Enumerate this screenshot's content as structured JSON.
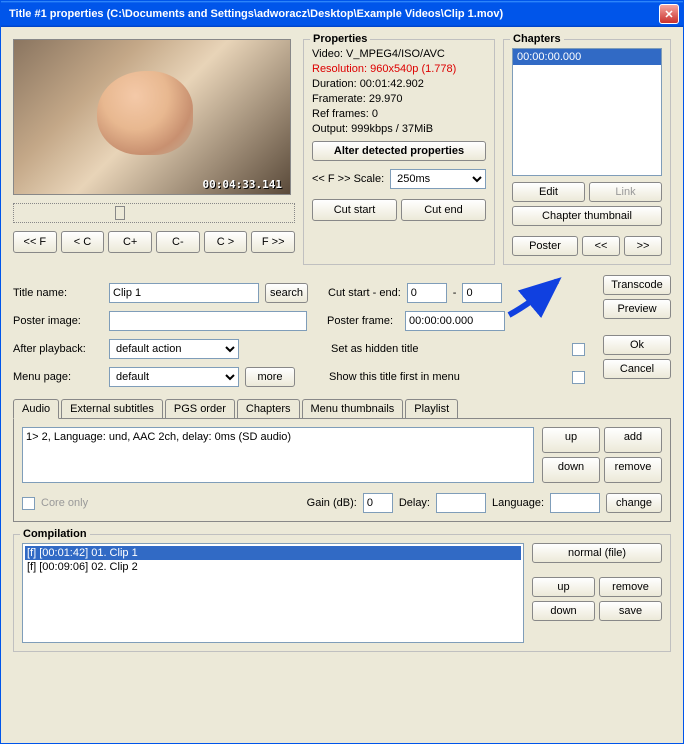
{
  "window": {
    "title": "Title #1 properties (C:\\Documents and Settings\\adworacz\\Desktop\\Example Videos\\Clip 1.mov)"
  },
  "preview": {
    "timecode": "00:04:33.141"
  },
  "nav": {
    "ff_back": "<< F",
    "c_back": "< C",
    "c_plus": "C+",
    "c_minus": "C-",
    "c_fwd": "C >",
    "ff_fwd": "F >>"
  },
  "properties": {
    "title": "Properties",
    "video": "Video: V_MPEG4/ISO/AVC",
    "resolution": "Resolution: 960x540p (1.778)",
    "duration": "Duration: 00:01:42.902",
    "framerate": "Framerate: 29.970",
    "ref_frames": "Ref frames: 0",
    "output": "Output: 999kbps / 37MiB",
    "alter_btn": "Alter detected properties",
    "scale_label": "<< F >> Scale:",
    "scale_value": "250ms",
    "cut_start": "Cut start",
    "cut_end": "Cut end"
  },
  "chapters": {
    "title": "Chapters",
    "items": [
      "00:00:00.000"
    ],
    "edit": "Edit",
    "link": "Link",
    "thumbnail": "Chapter thumbnail",
    "poster": "Poster",
    "prev": "<<",
    "next": ">>"
  },
  "form": {
    "title_name_label": "Title name:",
    "title_name_value": "Clip 1",
    "search": "search",
    "poster_image_label": "Poster image:",
    "poster_image_value": "",
    "after_playback_label": "After playback:",
    "after_playback_value": "default action",
    "menu_page_label": "Menu page:",
    "menu_page_value": "default",
    "more": "more",
    "cut_label": "Cut start - end:",
    "cut_start_value": "0",
    "cut_end_value": "0",
    "poster_frame_label": "Poster frame:",
    "poster_frame_value": "00:00:00.000",
    "hidden_label": "Set as hidden title",
    "show_first_label": "Show this title first in menu"
  },
  "actions": {
    "transcode": "Transcode",
    "preview": "Preview",
    "ok": "Ok",
    "cancel": "Cancel"
  },
  "tabs": {
    "audio": "Audio",
    "external_subtitles": "External subtitles",
    "pgs_order": "PGS order",
    "chapters": "Chapters",
    "menu_thumbnails": "Menu thumbnails",
    "playlist": "Playlist"
  },
  "audio": {
    "list_item": "1> 2, Language: und, AAC 2ch, delay: 0ms (SD audio)",
    "up": "up",
    "add": "add",
    "down": "down",
    "remove": "remove",
    "core_only": "Core only",
    "gain_label": "Gain (dB):",
    "gain_value": "0",
    "delay_label": "Delay:",
    "delay_value": "",
    "language_label": "Language:",
    "language_value": "",
    "change": "change"
  },
  "compilation": {
    "title": "Compilation",
    "items": [
      {
        "text": "[f] [00:01:42] 01. Clip 1",
        "selected": true
      },
      {
        "text": "[f] [00:09:06] 02. Clip 2",
        "selected": false
      }
    ],
    "normal": "normal (file)",
    "up": "up",
    "remove": "remove",
    "down": "down",
    "save": "save"
  }
}
